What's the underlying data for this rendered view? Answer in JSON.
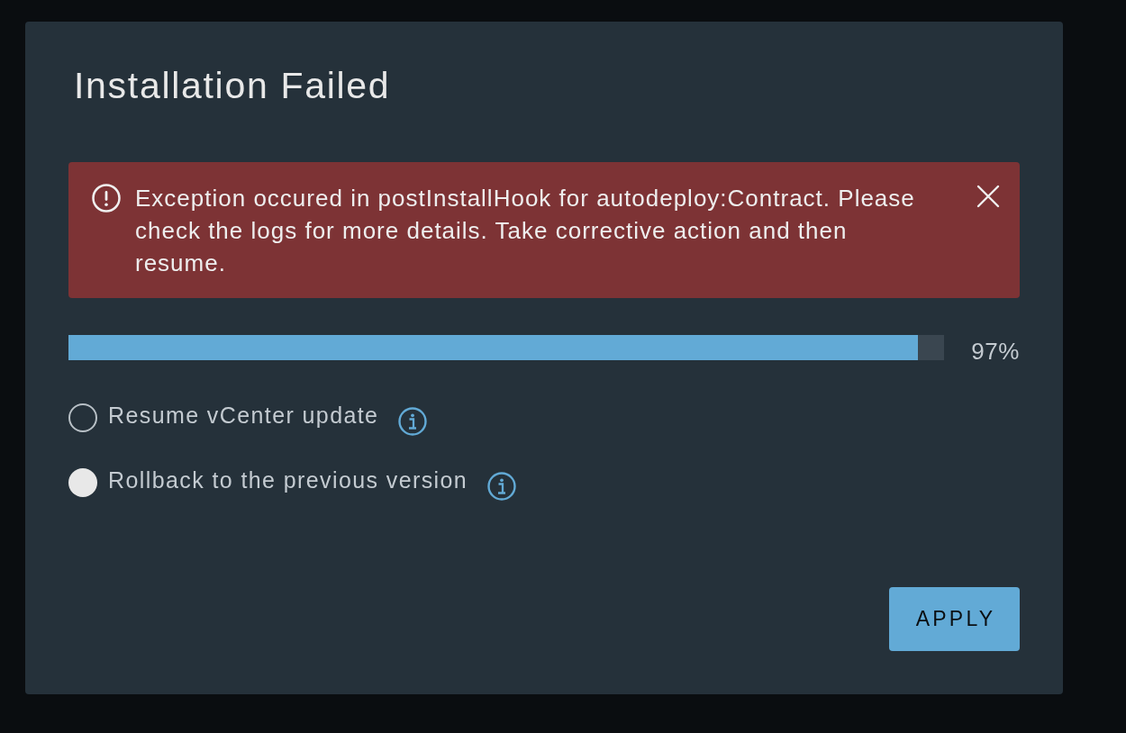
{
  "dialog": {
    "title": "Installation Failed",
    "alert": {
      "kind": "error",
      "message": "Exception occured in postInstallHook for autodeploy:Contract. Please check the logs for more details. Take corrective action and then resume.",
      "closable": true
    },
    "progress": {
      "level": 0.97,
      "reading": "97%"
    },
    "options": [
      {
        "label": "Resume vCenter update",
        "selected": false
      },
      {
        "label": "Rollback to the previous version",
        "selected": true
      }
    ],
    "buttons": [
      {
        "label": "APPLY"
      }
    ]
  }
}
